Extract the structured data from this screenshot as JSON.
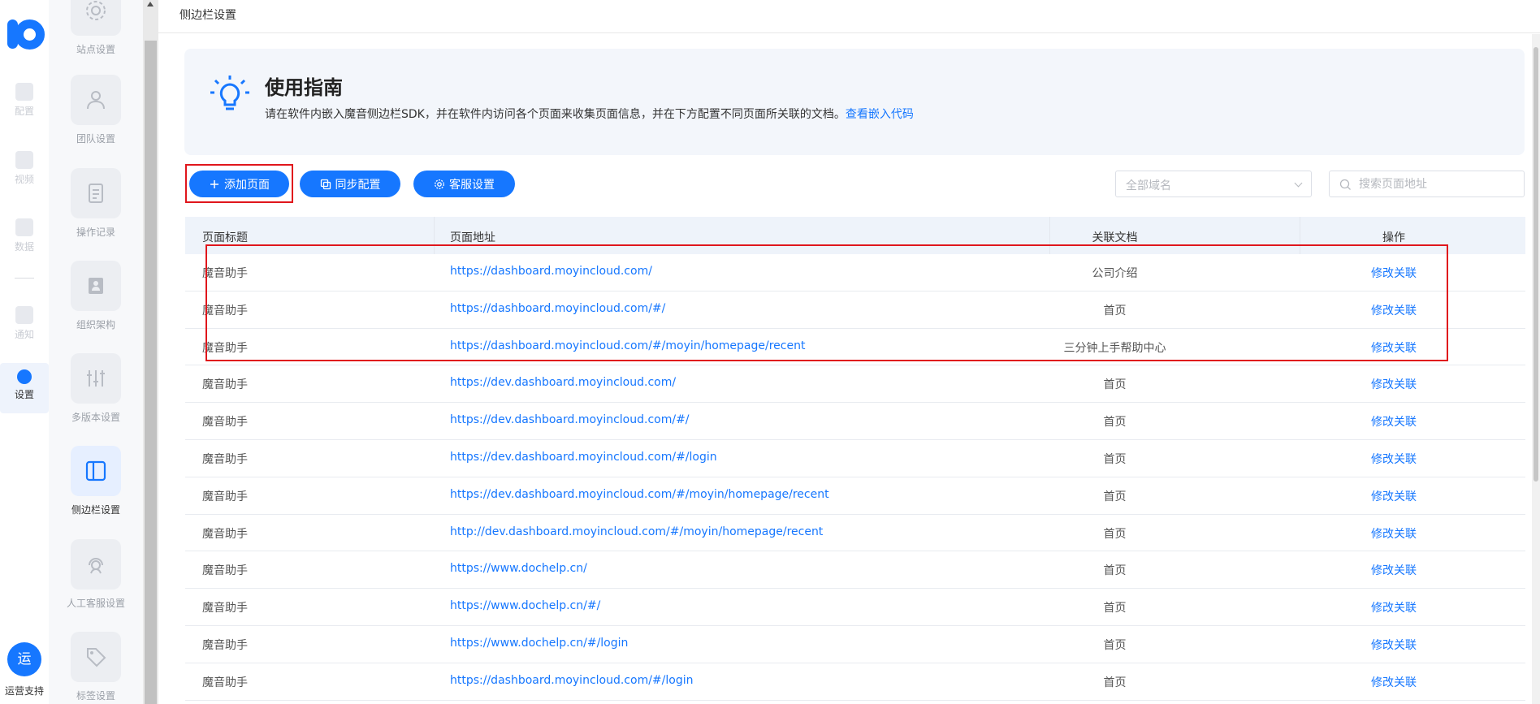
{
  "rail": {
    "items": [
      {
        "label": "配置"
      },
      {
        "label": "视频"
      },
      {
        "label": "数据"
      },
      {
        "label": "通知"
      },
      {
        "label": "设置"
      }
    ],
    "ops": {
      "icon_text": "运",
      "label": "运营支持"
    }
  },
  "submenu": {
    "items": [
      {
        "label": "站点设置",
        "icon": "gear-icon"
      },
      {
        "label": "团队设置",
        "icon": "team-icon"
      },
      {
        "label": "操作记录",
        "icon": "document-icon"
      },
      {
        "label": "组织架构",
        "icon": "contact-card-icon"
      },
      {
        "label": "多版本设置",
        "icon": "sliders-icon"
      },
      {
        "label": "侧边栏设置",
        "icon": "sidebar-layout-icon"
      },
      {
        "label": "人工客服设置",
        "icon": "customer-service-icon"
      },
      {
        "label": "标签设置",
        "icon": "tag-icon"
      }
    ]
  },
  "topbar": {
    "breadcrumb": "侧边栏设置"
  },
  "guide": {
    "title": "使用指南",
    "description": "请在软件内嵌入魔音侧边栏SDK，并在软件内访问各个页面来收集页面信息，并在下方配置不同页面所关联的文档。",
    "link": "查看嵌入代码"
  },
  "toolbar": {
    "add_page": "添加页面",
    "sync_config": "同步配置",
    "service_settings": "客服设置",
    "domain_select": "全部域名",
    "search_placeholder": "搜索页面地址"
  },
  "table": {
    "headers": {
      "title": "页面标题",
      "url": "页面地址",
      "doc": "关联文档",
      "action": "操作"
    },
    "rows": [
      {
        "title": "魔音助手",
        "url": "https://dashboard.moyincloud.com/",
        "doc": "公司介绍",
        "action": "修改关联"
      },
      {
        "title": "魔音助手",
        "url": "https://dashboard.moyincloud.com/#/",
        "doc": "首页",
        "action": "修改关联"
      },
      {
        "title": "魔音助手",
        "url": "https://dashboard.moyincloud.com/#/moyin/homepage/recent",
        "doc": "三分钟上手帮助中心",
        "action": "修改关联"
      },
      {
        "title": "魔音助手",
        "url": "https://dev.dashboard.moyincloud.com/",
        "doc": "首页",
        "action": "修改关联"
      },
      {
        "title": "魔音助手",
        "url": "https://dev.dashboard.moyincloud.com/#/",
        "doc": "首页",
        "action": "修改关联"
      },
      {
        "title": "魔音助手",
        "url": "https://dev.dashboard.moyincloud.com/#/login",
        "doc": "首页",
        "action": "修改关联"
      },
      {
        "title": "魔音助手",
        "url": "https://dev.dashboard.moyincloud.com/#/moyin/homepage/recent",
        "doc": "首页",
        "action": "修改关联"
      },
      {
        "title": "魔音助手",
        "url": "http://dev.dashboard.moyincloud.com/#/moyin/homepage/recent",
        "doc": "首页",
        "action": "修改关联"
      },
      {
        "title": "魔音助手",
        "url": "https://www.dochelp.cn/",
        "doc": "首页",
        "action": "修改关联"
      },
      {
        "title": "魔音助手",
        "url": "https://www.dochelp.cn/#/",
        "doc": "首页",
        "action": "修改关联"
      },
      {
        "title": "魔音助手",
        "url": "https://www.dochelp.cn/#/login",
        "doc": "首页",
        "action": "修改关联"
      },
      {
        "title": "魔音助手",
        "url": "https://dashboard.moyincloud.com/#/login",
        "doc": "首页",
        "action": "修改关联"
      }
    ]
  },
  "colors": {
    "accent": "#1677ff",
    "highlight": "#e0161c",
    "guide_bg": "#f3f6fb",
    "header_bg": "#eef3fa"
  }
}
